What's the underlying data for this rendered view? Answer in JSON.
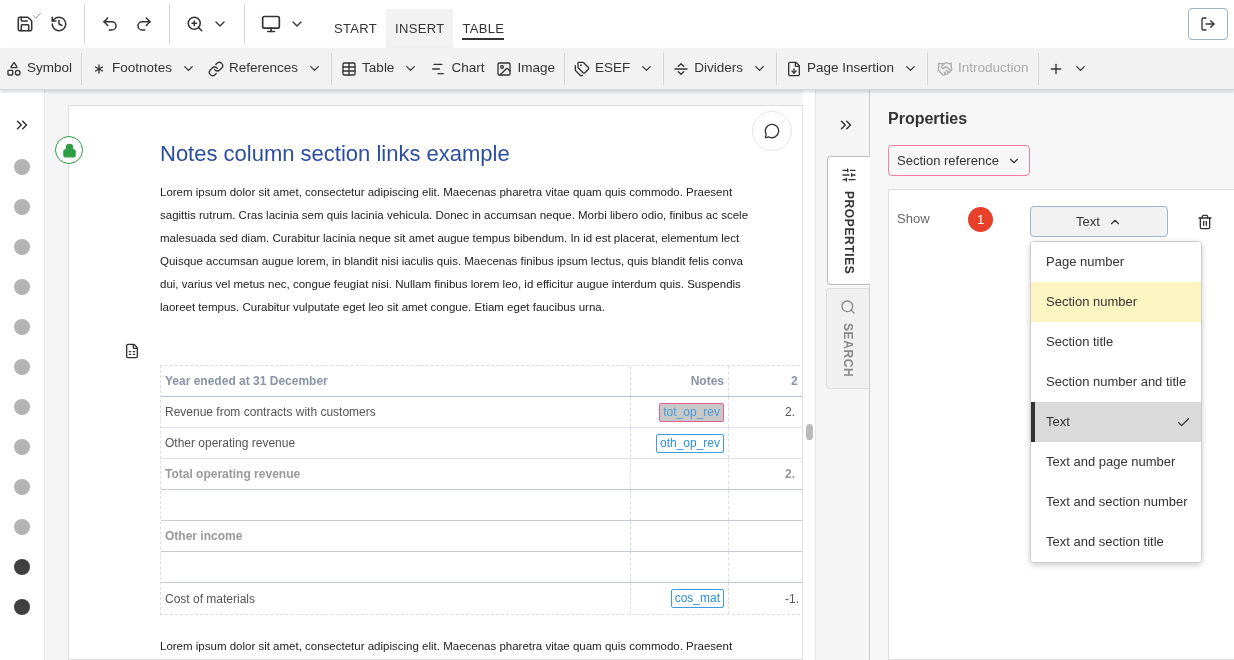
{
  "top_toolbar": {
    "tabs": [
      {
        "label": "START",
        "selected": false,
        "underlined": false
      },
      {
        "label": "INSERT",
        "selected": true,
        "underlined": false
      },
      {
        "label": "TABLE",
        "selected": false,
        "underlined": true
      }
    ],
    "saved": true
  },
  "insert_toolbar": [
    {
      "label": "Symbol",
      "dropdown": false,
      "disabled": false,
      "group_start": false
    },
    {
      "label": "Footnotes",
      "dropdown": true,
      "disabled": false,
      "group_start": true
    },
    {
      "label": "References",
      "dropdown": true,
      "disabled": false,
      "group_start": false
    },
    {
      "label": "Table",
      "dropdown": true,
      "disabled": false,
      "group_start": true
    },
    {
      "label": "Chart",
      "dropdown": false,
      "disabled": false,
      "group_start": false
    },
    {
      "label": "Image",
      "dropdown": false,
      "disabled": false,
      "group_start": false
    },
    {
      "label": "ESEF",
      "dropdown": true,
      "disabled": false,
      "group_start": true
    },
    {
      "label": "Dividers",
      "dropdown": true,
      "disabled": false,
      "group_start": true
    },
    {
      "label": "Page Insertion",
      "dropdown": true,
      "disabled": false,
      "group_start": true
    },
    {
      "label": "Introduction",
      "dropdown": false,
      "disabled": true,
      "group_start": true
    },
    {
      "dropdown": true,
      "disabled": false,
      "group_start": true,
      "kind": "add"
    }
  ],
  "section_dots": [
    {
      "color": "#b3b3b3"
    },
    {
      "color": "#b3b3b3"
    },
    {
      "color": "#b3b3b3"
    },
    {
      "color": "#b3b3b3"
    },
    {
      "color": "#b3b3b3"
    },
    {
      "color": "#b3b3b3"
    },
    {
      "color": "#b3b3b3"
    },
    {
      "color": "#b3b3b3"
    },
    {
      "color": "#b3b3b3"
    },
    {
      "color": "#b3b3b3"
    },
    {
      "color": "#404040"
    },
    {
      "color": "#404040"
    }
  ],
  "document": {
    "title": "Notes column section links example",
    "locked": true,
    "paragraph_1": [
      "Lorem ipsum dolor sit amet, consectetur adipiscing elit. Maecenas pharetra vitae quam quis commodo. Praesent",
      "sagittis rutrum. Cras lacinia sem quis lacinia vehicula. Donec in accumsan neque. Morbi libero odio, finibus ac scele",
      "malesuada sed diam. Curabitur lacinia neque sit amet augue tempus bibendum. In id est placerat, elementum lect",
      "Quisque accumsan augue lorem, in blandit nisi iaculis quis. Maecenas finibus ipsum lectus, quis blandit felis conva",
      "dui, varius vel metus nec, congue feugiat nisi. Nullam finibus lorem leo, id efficitur augue interdum quis. Suspendis",
      "laoreet tempus. Curabitur vulputate eget leo sit amet congue. Etiam eget faucibus urna."
    ],
    "table": {
      "columns": [
        "Year eneded at 31 December",
        "Notes",
        "2"
      ],
      "rows": [
        {
          "kind": "line",
          "label": "Revenue from contracts with customers",
          "note": {
            "text": "tot_op_rev",
            "selected": true
          },
          "value": "2."
        },
        {
          "kind": "line",
          "label": "Other operating revenue",
          "note": {
            "text": "oth_op_rev",
            "selected": false
          }
        },
        {
          "kind": "total",
          "label": "Total operating revenue",
          "value": "2."
        },
        {
          "kind": "blank"
        },
        {
          "kind": "total",
          "label": "Other income"
        },
        {
          "kind": "blank"
        },
        {
          "kind": "line",
          "label": "Cost of materials",
          "note": {
            "text": "cos_mat",
            "selected": false
          },
          "value": "-1."
        }
      ]
    },
    "paragraph_2": [
      "Lorem ipsum dolor sit amet, consectetur adipiscing elit. Maecenas pharetra vitae quam quis commodo. Praesent"
    ]
  },
  "side_tabs": [
    {
      "label": "PROPERTIES",
      "selected": true
    },
    {
      "label": "SEARCH",
      "selected": false
    }
  ],
  "properties": {
    "title": "Properties",
    "type_select": "Section reference",
    "show_label": "Show",
    "badge": "1",
    "show_select": {
      "value": "Text",
      "expanded": true
    },
    "options": [
      {
        "label": "Page number",
        "selected": false,
        "highlighted": false
      },
      {
        "label": "Section number",
        "selected": false,
        "highlighted": true
      },
      {
        "label": "Section title",
        "selected": false,
        "highlighted": false
      },
      {
        "label": "Section number and title",
        "selected": false,
        "highlighted": false
      },
      {
        "label": "Text",
        "selected": true,
        "highlighted": false
      },
      {
        "label": "Text and page number",
        "selected": false,
        "highlighted": false
      },
      {
        "label": "Text and section number",
        "selected": false,
        "highlighted": false
      },
      {
        "label": "Text and section title",
        "selected": false,
        "highlighted": false
      }
    ]
  }
}
